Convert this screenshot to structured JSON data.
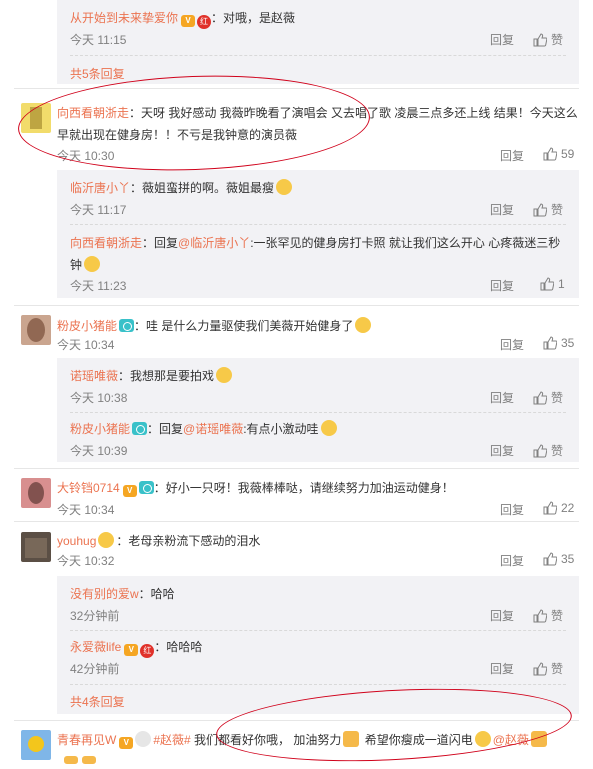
{
  "comments": [
    {
      "user": "从开始到未来挚爱你",
      "text": "：对哦，是赵薇",
      "time": "今天 11:15",
      "reply": "回复",
      "like": "赞"
    },
    {
      "more": "共5条回复"
    },
    {
      "user": "向西看朝浙走",
      "text": "：天呀 我好感动 我薇昨晚看了演唱会 又去唱了歌 凌晨三点多还上线 结果！今天这么早就出现在健身房！！不亏是我钟意的演员薇",
      "time": "今天 10:30",
      "reply": "回复",
      "like": "59"
    },
    {
      "user": "临沂唐小丫",
      "text": "：薇姐蛮拼的啊。薇姐最瘦",
      "time": "今天 11:17",
      "reply": "回复",
      "like": "赞"
    },
    {
      "user": "向西看朝浙走",
      "text_a": "：回复",
      "mention": "@临沂唐小丫",
      "text_b": ":一张罕见的健身房打卡照 就让我们这么开心 心疼薇迷三秒钟",
      "time": "今天 11:23",
      "reply": "回复",
      "like": "1"
    },
    {
      "user": "粉皮小猪能",
      "text": "：哇 是什么力量驱使我们美薇开始健身了",
      "time": "今天 10:34",
      "reply": "回复",
      "like": "35"
    },
    {
      "user": "诺瑶唯薇",
      "text": "：我想那是要拍戏",
      "time": "今天 10:38",
      "reply": "回复",
      "like": "赞"
    },
    {
      "user": "粉皮小猪能",
      "text_a": "：回复",
      "mention": "@诺瑶唯薇",
      "text_b": ":有点小激动哇",
      "time": "今天 10:39",
      "reply": "回复",
      "like": "赞"
    },
    {
      "user": "大铃铛0714",
      "text": "：好小一只呀！我薇棒棒哒，请继续努力加油运动健身！",
      "time": "今天 10:34",
      "reply": "回复",
      "like": "22"
    },
    {
      "user": "youhug",
      "text": "：老母亲粉流下感动的泪水",
      "time": "今天 10:32",
      "reply": "回复",
      "like": "35"
    },
    {
      "user": "没有别的爱w",
      "text": "：哈哈",
      "time": "32分钟前",
      "reply": "回复",
      "like": "赞"
    },
    {
      "user": "永爱薇life",
      "text": "：哈哈哈",
      "time": "42分钟前",
      "reply": "回复",
      "like": "赞"
    },
    {
      "more": "共4条回复"
    },
    {
      "user": "青春再见W",
      "hashtag": "#赵薇#",
      "text": " 我们都看好你哦， 加油努力",
      "text_b": " 希望你瘦成一道闪电",
      "mention": "@赵薇"
    }
  ],
  "colors": {
    "accent": "#eb7350",
    "panel": "#f2f2f5",
    "annotation": "#d0021b"
  },
  "icons": [
    "thumb-up-icon",
    "vip-crown-icon",
    "red-badge-icon",
    "camera-badge-icon",
    "emoji-icon",
    "strong-arm-icon"
  ]
}
